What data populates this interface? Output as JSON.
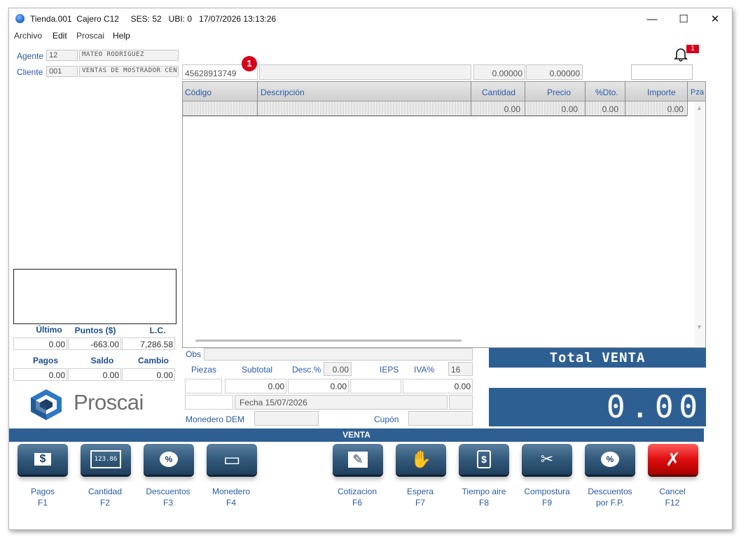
{
  "window": {
    "title": "Tienda.001  Cajero C12     SES: 52   UBI: 0   17/07/2026 13:13:26",
    "minimize": "—",
    "maximize": "☐",
    "close": "✕"
  },
  "menu": [
    "Archivo",
    "Edit",
    "Proscai",
    "Help"
  ],
  "left": {
    "agente_label": "Agente",
    "agente_code": "12",
    "agente_name": "MATEO RODRIGUEZ",
    "cliente_label": "Cliente",
    "cliente_code": "001",
    "cliente_name": "VENTAS DE MOSTRADOR CEN",
    "ultimo_label": "Último",
    "puntos_label": "Puntos ($)",
    "lc_label": "L.C.",
    "ultimo_value": "0.00",
    "puntos_value": "-663.00",
    "lc_value": "7,286.58",
    "pagos_label": "Pagos",
    "saldo_label": "Saldo",
    "cambio_label": "Cambio",
    "pagos_value": "0.00",
    "saldo_value": "0.00",
    "cambio_value": "0.00",
    "logo_text": "Proscai"
  },
  "entry": {
    "code": "45628913749",
    "badge": "1",
    "qty": "0.00000",
    "price": "0.00000",
    "notif_count": "1"
  },
  "grid": {
    "columns": [
      "Código",
      "Descripción",
      "Cantidad",
      "Precio",
      "%Dto.",
      "Importe",
      "Pza"
    ],
    "row": [
      "0.00",
      "0.00",
      "0.00",
      "0.00"
    ]
  },
  "totals": {
    "obs_label": "Obs",
    "piezas_label": "Piezas",
    "subtotal_label": "Subtotal",
    "desc_label": "Desc.%",
    "desc_value": "0.00",
    "ieps_label": "IEPS",
    "iva_label": "IVA%",
    "iva_value": "16",
    "subtotal_value": "0.00",
    "desc_amount": "0.00",
    "total_small": "0.00",
    "fecha": "Fecha 15/07/2026",
    "monedero_label": "Monedero DEM",
    "cupon_label": "Cupón",
    "total_title": "Total VENTA",
    "total_value": "0.00"
  },
  "status_bar": "VENTA",
  "actions": [
    {
      "label": "Pagos",
      "key": "F1",
      "icon": "$"
    },
    {
      "label": "Cantidad",
      "key": "F2",
      "icon": "123.86"
    },
    {
      "label": "Descuentos",
      "key": "F3",
      "icon": "%"
    },
    {
      "label": "Monedero",
      "key": "F4",
      "icon": "▭"
    },
    {
      "label": "Cotizacion",
      "key": "F6",
      "icon": "✎"
    },
    {
      "label": "Espera",
      "key": "F7",
      "icon": "✋"
    },
    {
      "label": "Tiempo aire",
      "key": "F8",
      "icon": "$"
    },
    {
      "label": "Compostura",
      "key": "F9",
      "icon": "✂"
    },
    {
      "label": "Descuentos",
      "label2": "por F.P.",
      "key": "",
      "icon": "%"
    },
    {
      "label": "Cancel",
      "key": "F12",
      "icon": "✗"
    }
  ],
  "colors": {
    "accent_blue": "#2e5f93",
    "label_blue": "#2a5aa8",
    "cancel_red": "#e00e0e",
    "badge_red": "#d6001c"
  }
}
